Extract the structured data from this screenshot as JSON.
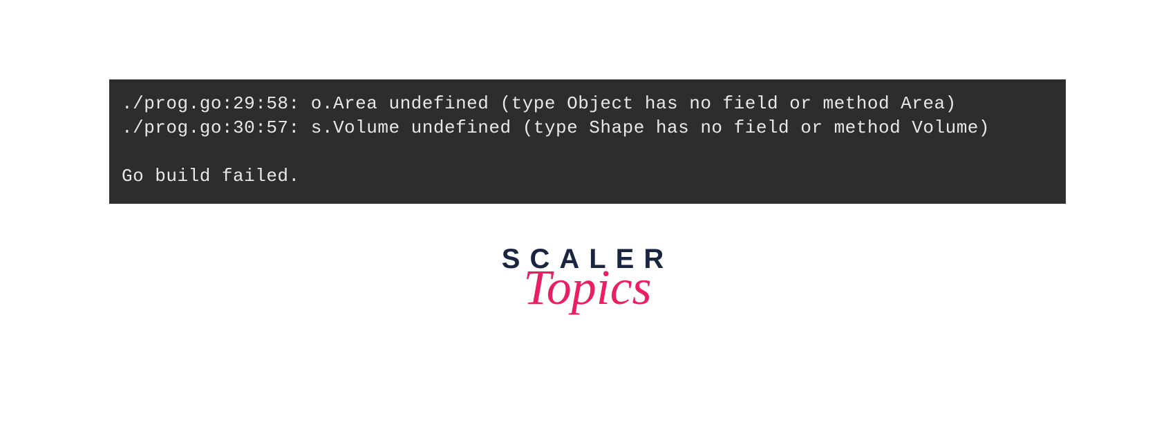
{
  "terminal": {
    "line1": "./prog.go:29:58: o.Area undefined (type Object has no field or method Area)",
    "line2": "./prog.go:30:57: s.Volume undefined (type Shape has no field or method Volume)",
    "line3": "",
    "line4": "Go build failed."
  },
  "logo": {
    "primary": "SCALER",
    "secondary": "Topics"
  }
}
